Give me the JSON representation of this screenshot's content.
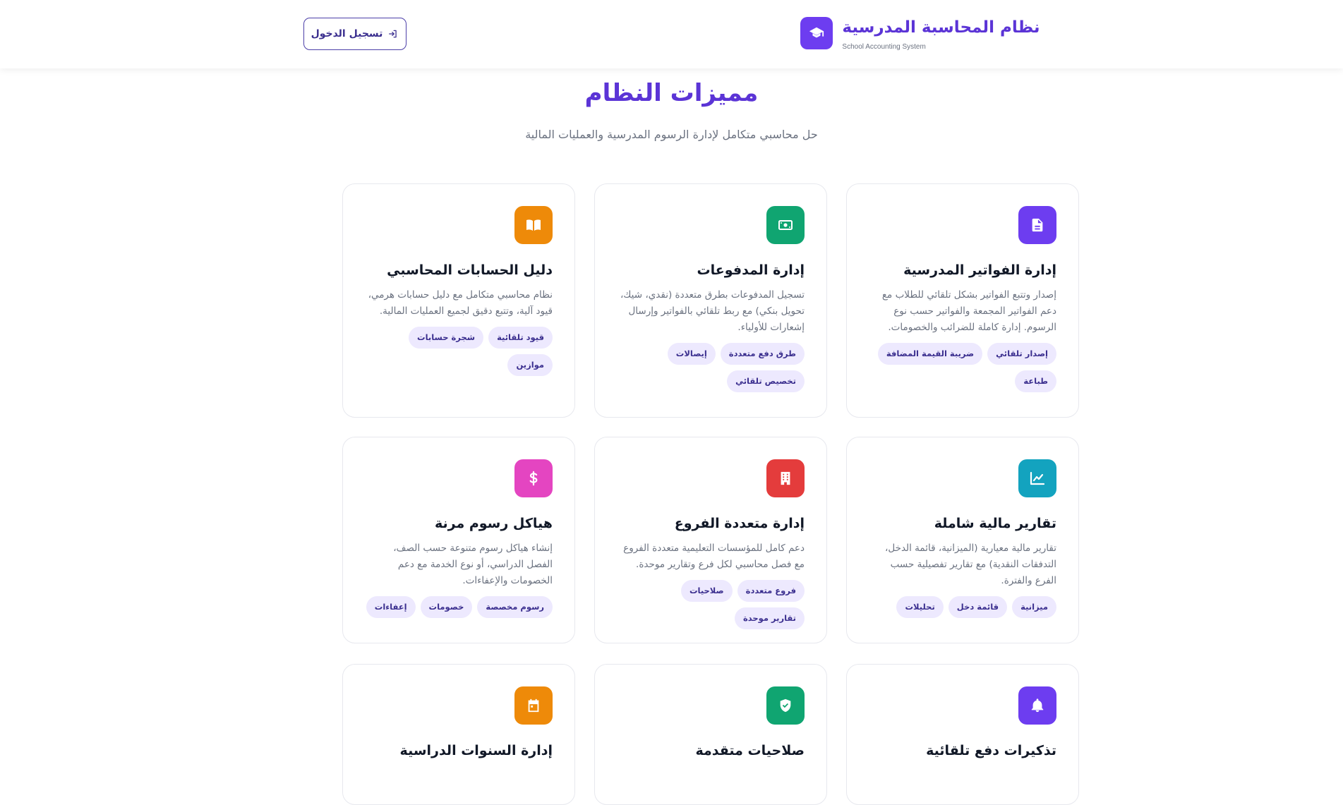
{
  "header": {
    "brand_title": "نظام المحاسبة المدرسية",
    "brand_subtitle": "School Accounting System",
    "login_label": "تسجيل الدخول",
    "brand_icon": "graduation-cap-icon",
    "brand_color": "#6d3df0"
  },
  "features": {
    "title": "مميزات النظام",
    "subtitle": "حل محاسبي متكامل لإدارة الرسوم المدرسية والعمليات المالية",
    "cards": [
      {
        "icon": "document-icon",
        "color": "#6d3df0",
        "title": "إدارة الفواتير المدرسية",
        "description": "إصدار وتتبع الفواتير بشكل تلقائي للطلاب مع دعم الفواتير المجمعة والفواتير حسب نوع الرسوم. إدارة كاملة للضرائب والخصومات.",
        "tags": [
          "إصدار تلقائي",
          "ضريبة القيمة المضافة",
          "طباعة"
        ]
      },
      {
        "icon": "cash-icon",
        "color": "#10a571",
        "title": "إدارة المدفوعات",
        "description": "تسجيل المدفوعات بطرق متعددة (نقدي، شيك، تحويل بنكي) مع ربط تلقائي بالفواتير وإرسال إشعارات للأولياء.",
        "tags": [
          "طرق دفع متعددة",
          "إيصالات",
          "تخصيص تلقائي"
        ]
      },
      {
        "icon": "book-icon",
        "color": "#ee8a09",
        "title": "دليل الحسابات المحاسبي",
        "description": "نظام محاسبي متكامل مع دليل حسابات هرمي، قيود آلية، وتتبع دقيق لجميع العمليات المالية.",
        "tags": [
          "قيود تلقائية",
          "شجرة حسابات",
          "موازين"
        ]
      },
      {
        "icon": "chart-line-icon",
        "color": "#13a3bf",
        "title": "تقارير مالية شاملة",
        "description": "تقارير مالية معيارية (الميزانية، قائمة الدخل، التدفقات النقدية) مع تقارير تفصيلية حسب الفرع والفترة.",
        "tags": [
          "ميزانية",
          "قائمة دخل",
          "تحليلات"
        ]
      },
      {
        "icon": "building-icon",
        "color": "#e43c3c",
        "title": "إدارة متعددة الفروع",
        "description": "دعم كامل للمؤسسات التعليمية متعددة الفروع مع فصل محاسبي لكل فرع وتقارير موحدة.",
        "tags": [
          "فروع متعددة",
          "صلاحيات",
          "تقارير موحدة"
        ]
      },
      {
        "icon": "dollar-icon",
        "color": "#e445c1",
        "title": "هياكل رسوم مرنة",
        "description": "إنشاء هياكل رسوم متنوعة حسب الصف، الفصل الدراسي، أو نوع الخدمة مع دعم الخصومات والإعفاءات.",
        "tags": [
          "رسوم مخصصة",
          "خصومات",
          "إعفاءات"
        ]
      },
      {
        "icon": "bell-icon",
        "color": "#6d3df0",
        "title": "تذكيرات دفع تلقائية",
        "description": "",
        "tags": []
      },
      {
        "icon": "shield-check-icon",
        "color": "#10a571",
        "title": "صلاحيات متقدمة",
        "description": "",
        "tags": []
      },
      {
        "icon": "calendar-icon",
        "color": "#ee8a09",
        "title": "إدارة السنوات الدراسية",
        "description": "",
        "tags": []
      }
    ]
  }
}
